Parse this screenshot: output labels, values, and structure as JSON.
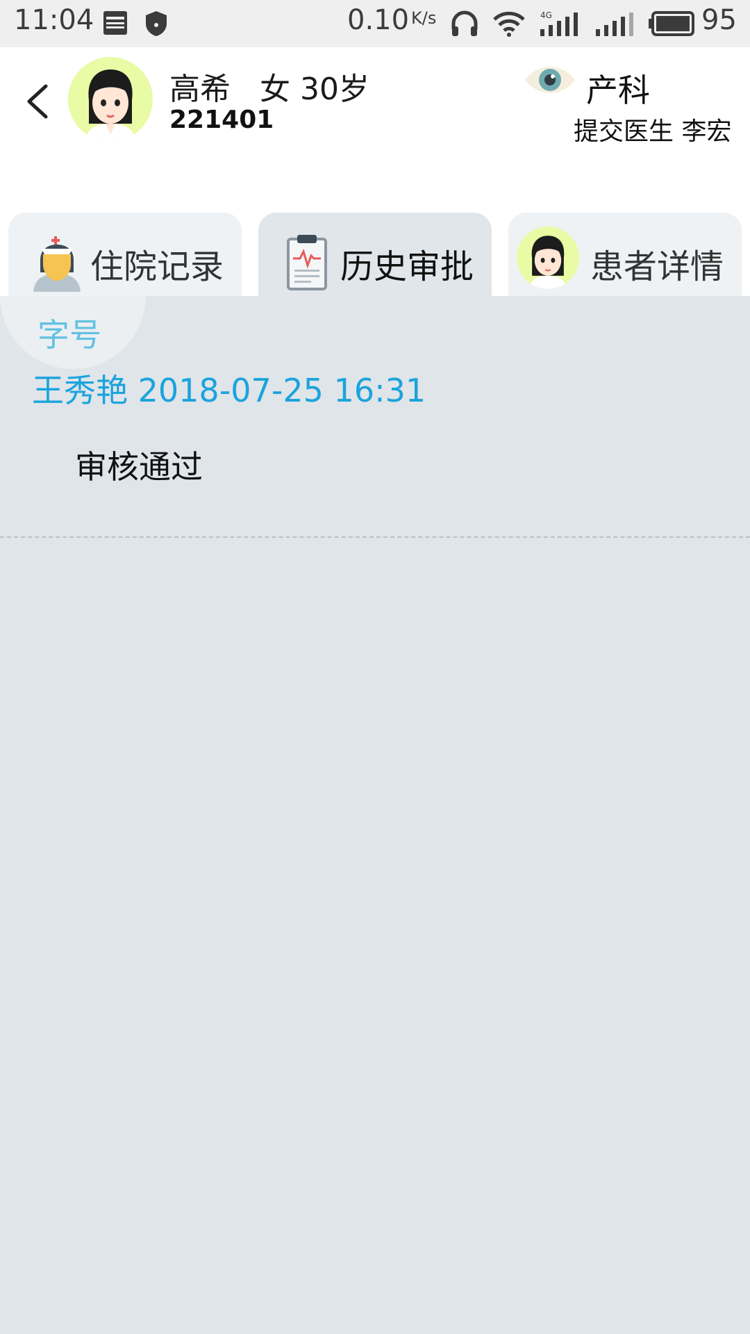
{
  "status": {
    "time": "11:04",
    "speed": "0.10",
    "speed_unit": "K/s",
    "battery": "95"
  },
  "patient": {
    "name_line": "高希   女 30岁",
    "id": "221401",
    "department": "产科",
    "doctor": "提交医生 李宏"
  },
  "tabs": [
    {
      "label": "住院记录"
    },
    {
      "label": "历史审批"
    },
    {
      "label": "患者详情"
    }
  ],
  "font_size_label": "字号",
  "records": [
    {
      "header": "王秀艳 2018-07-25 16:31",
      "body": "审核通过"
    }
  ],
  "colors": {
    "accent_blue": "#1ba3dd",
    "light_blue": "#62c1e2",
    "content_bg": "#dfe5e9",
    "avatar_bg": "#e9fba4"
  }
}
